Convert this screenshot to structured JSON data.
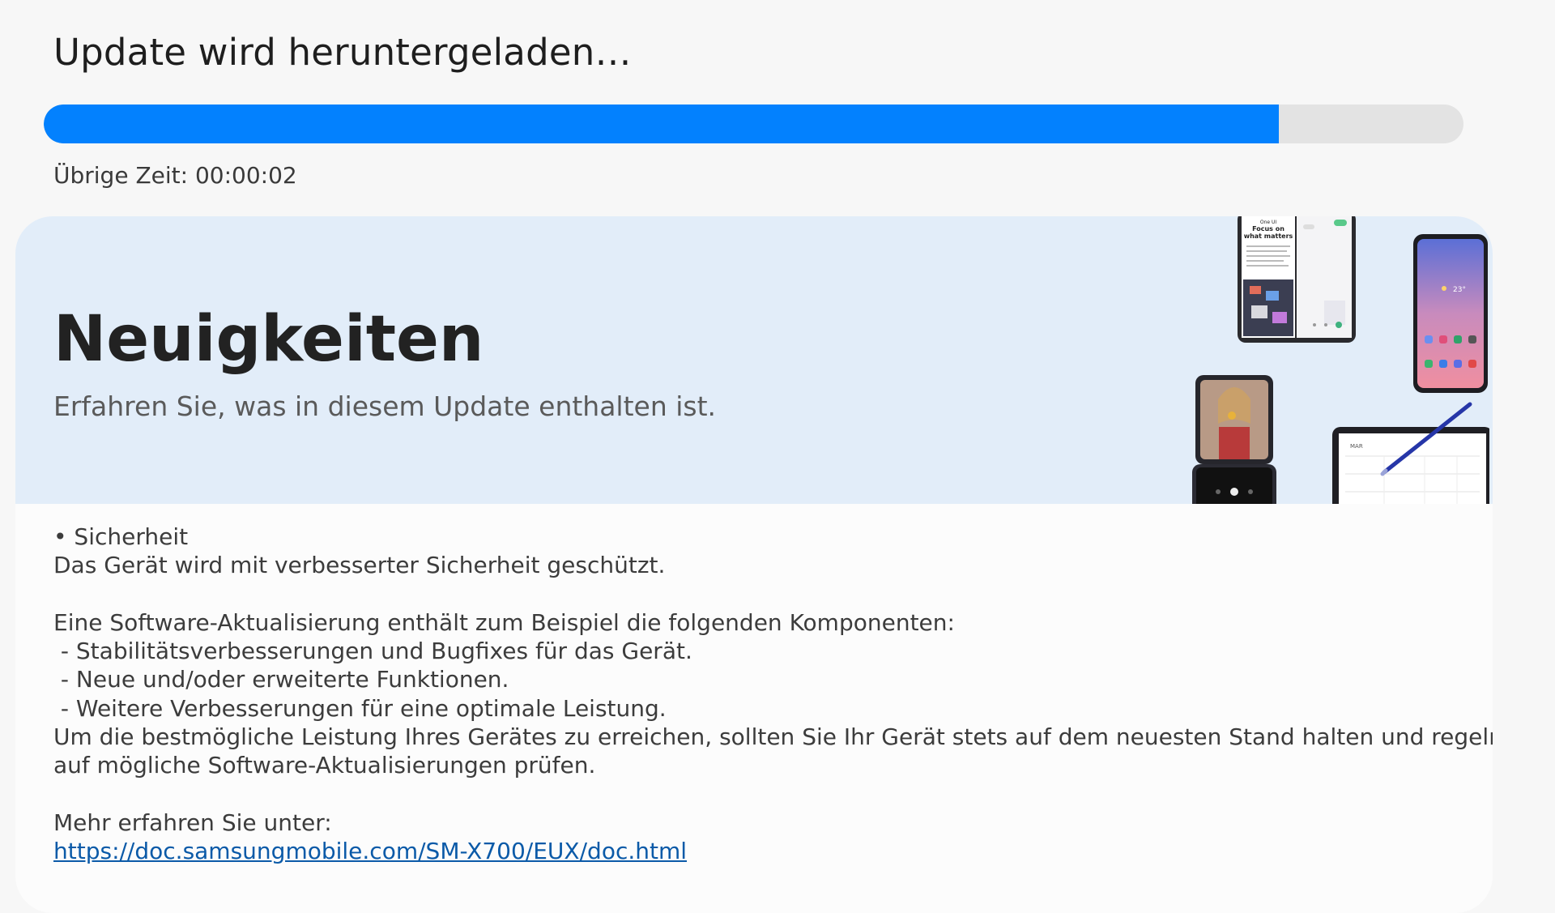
{
  "header": {
    "title": "Update wird heruntergeladen…",
    "remaining_time": "Übrige Zeit: 00:00:02"
  },
  "progress": {
    "fraction": 0.87,
    "fill_color": "#0381fe",
    "track_color": "#e3e3e3"
  },
  "banner": {
    "title": "Neuigkeiten",
    "subtitle": "Erfahren Sie, was in diesem Update enthalten ist.",
    "background": "#e2edf9",
    "illustration_text": {
      "foldable_heading": "Focus on what matters",
      "foldable_brand": "One UI",
      "phone_temp": "23°",
      "tablet_month": "MAR"
    }
  },
  "notes": {
    "section_bullet": "• Sicherheit",
    "section_text": "Das Gerät wird mit verbesserter Sicherheit geschützt.",
    "intro": "Eine Software-Aktualisierung enthält zum Beispiel die folgenden Komponenten:",
    "items": [
      " - Stabilitätsverbesserungen und Bugfixes für das Gerät.",
      " - Neue und/oder erweiterte Funktionen.",
      " - Weitere Verbesserungen für eine optimale Leistung."
    ],
    "closing_line1": "Um die bestmögliche Leistung Ihres Gerätes zu erreichen, sollten Sie Ihr Gerät stets auf dem neuesten Stand halten und regelmäßig",
    "closing_line2": "auf mögliche Software-Aktualisierungen prüfen.",
    "more_label": "Mehr erfahren Sie unter:",
    "more_link": "https://doc.samsungmobile.com/SM-X700/EUX/doc.html"
  }
}
